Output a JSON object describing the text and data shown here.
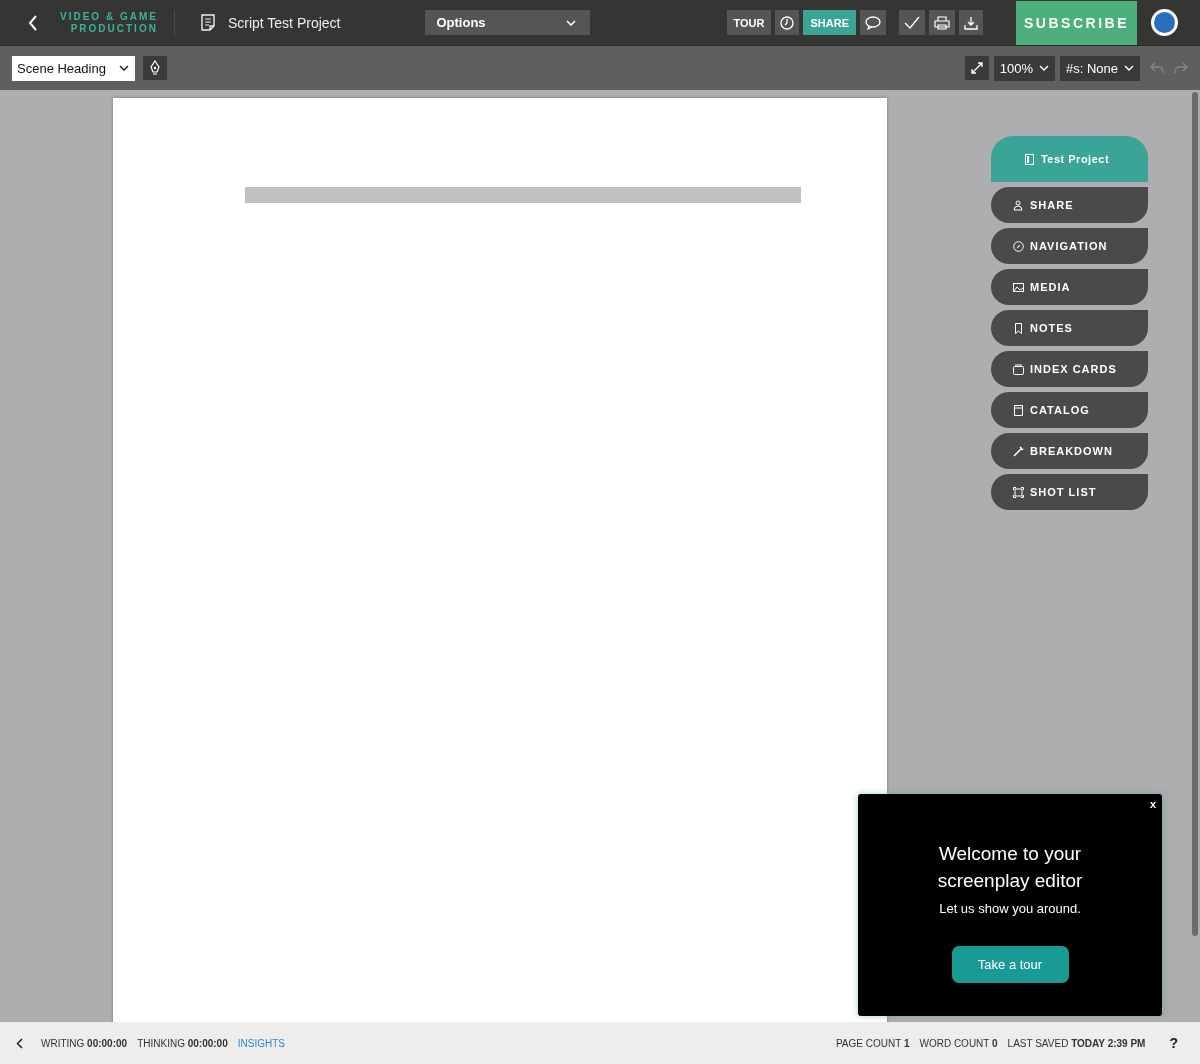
{
  "top_bar": {
    "brand": [
      "VIDEO & GAME",
      "PRODUCTION"
    ],
    "document_title": "Script Test Project",
    "options_dropdown": "Options",
    "tour_button": "TOUR",
    "share_button": "SHARE",
    "subscribe_button": "SUBSCRIBE"
  },
  "toolbar": {
    "element_type": "Scene Heading",
    "zoom": "100%",
    "scene_numbers": "#s: None"
  },
  "side_menu": [
    {
      "label": "Test Project",
      "selected": true
    },
    {
      "label": "SHARE",
      "selected": false
    },
    {
      "label": "NAVIGATION",
      "selected": false
    },
    {
      "label": "MEDIA",
      "selected": false
    },
    {
      "label": "NOTES",
      "selected": false
    },
    {
      "label": "INDEX CARDS",
      "selected": false
    },
    {
      "label": "CATALOG",
      "selected": false
    },
    {
      "label": "BREAKDOWN",
      "selected": false
    },
    {
      "label": "SHOT LIST",
      "selected": false
    }
  ],
  "welcome_popup": {
    "close": "x",
    "title": "Welcome to your screenplay editor",
    "text": "Let us show you around.",
    "button": "Take a tour"
  },
  "status_bar": {
    "left": [
      {
        "text": "WRITING **00:00:00**"
      },
      {
        "text": "THINKING **00:00:00**"
      }
    ],
    "insights_link": "INSIGHTS",
    "right": [
      {
        "text": "PAGE COUNT **1**"
      },
      {
        "text": "WORD COUNT **0**"
      },
      {
        "text": "LAST SAVED **TODAY 2:39 PM**"
      }
    ],
    "help": "?"
  }
}
